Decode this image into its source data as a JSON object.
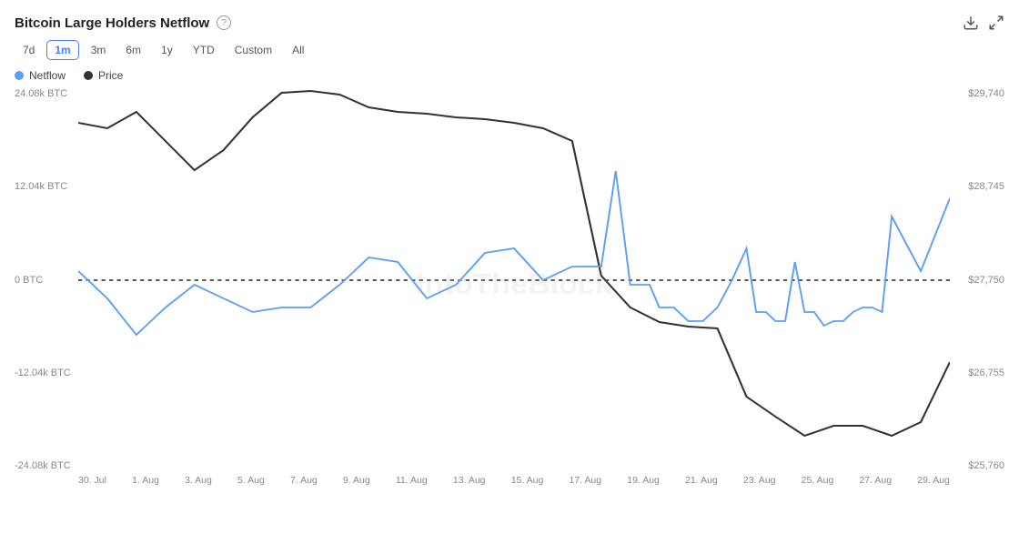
{
  "title": "Bitcoin Large Holders Netflow",
  "timeFilters": [
    "7d",
    "1m",
    "3m",
    "6m",
    "1y",
    "YTD",
    "Custom",
    "All"
  ],
  "activeFilter": "1m",
  "legend": [
    {
      "label": "Netflow",
      "color": "#5b9ef4"
    },
    {
      "label": "Price",
      "color": "#333"
    }
  ],
  "yAxisLeft": [
    "24.08k BTC",
    "12.04k BTC",
    "0 BTC",
    "-12.04k BTC",
    "-24.08k BTC"
  ],
  "yAxisRight": [
    "$29,740",
    "$28,745",
    "$27,750",
    "$26,755",
    "$25,760"
  ],
  "xAxisLabels": [
    "30. Jul",
    "1. Aug",
    "3. Aug",
    "5. Aug",
    "7. Aug",
    "9. Aug",
    "11. Aug",
    "13. Aug",
    "15. Aug",
    "17. Aug",
    "19. Aug",
    "21. Aug",
    "23. Aug",
    "25. Aug",
    "27. Aug",
    "29. Aug"
  ],
  "watermark": "IntoTheBlock",
  "downloadIcon": "⬇",
  "expandIcon": "⛶"
}
